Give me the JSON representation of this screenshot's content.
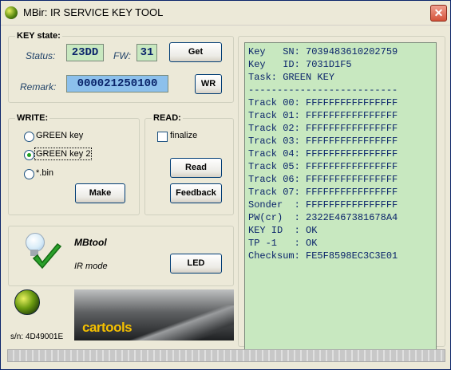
{
  "window": {
    "title": "MBir: IR SERVICE KEY TOOL",
    "close_label": "✕"
  },
  "key_state": {
    "group_title": "KEY state:",
    "status_label": "Status:",
    "status_value": "23DD",
    "fw_label": "FW:",
    "fw_value": "31",
    "get_label": "Get",
    "remark_label": "Remark:",
    "remark_value": "000021250100",
    "wr_label": "WR"
  },
  "write": {
    "group_title": "WRITE:",
    "options": [
      {
        "label": "GREEN key",
        "checked": false
      },
      {
        "label": "GREEN key 2",
        "checked": true
      },
      {
        "label": "*.bin",
        "checked": false
      }
    ],
    "make_label": "Make"
  },
  "read": {
    "group_title": "READ:",
    "finalize_label": "finalize",
    "finalize_checked": false,
    "read_label": "Read",
    "feedback_label": "Feedback"
  },
  "mbtool": {
    "title": "MBtool",
    "mode": "IR mode",
    "led_label": "LED"
  },
  "banner": {
    "brand": "cartools"
  },
  "serial": "s/n: 4D49001E",
  "output": {
    "lines": [
      "Key   SN: 7039483610202759",
      "Key   ID: 7031D1F5",
      "Task: GREEN KEY",
      "--------------------------",
      "Track 00: FFFFFFFFFFFFFFFF",
      "Track 01: FFFFFFFFFFFFFFFF",
      "Track 02: FFFFFFFFFFFFFFFF",
      "Track 03: FFFFFFFFFFFFFFFF",
      "Track 04: FFFFFFFFFFFFFFFF",
      "Track 05: FFFFFFFFFFFFFFFF",
      "Track 06: FFFFFFFFFFFFFFFF",
      "Track 07: FFFFFFFFFFFFFFFF",
      "Sonder  : FFFFFFFFFFFFFFFF",
      "PW(cr)  : 2322E467381678A4",
      "KEY ID  : OK",
      "TP -1   : OK",
      "Checksum: FE5F8598EC3C3E01"
    ]
  },
  "colors": {
    "lcd_green": "#c8e8c0",
    "remark_blue": "#8cc0ec",
    "window_bg": "#ece9d8"
  },
  "icons": {
    "title": "globe-icon",
    "bulb": "light-bulb-icon",
    "check": "green-check-icon",
    "globe": "globe-icon",
    "close": "close-icon"
  }
}
